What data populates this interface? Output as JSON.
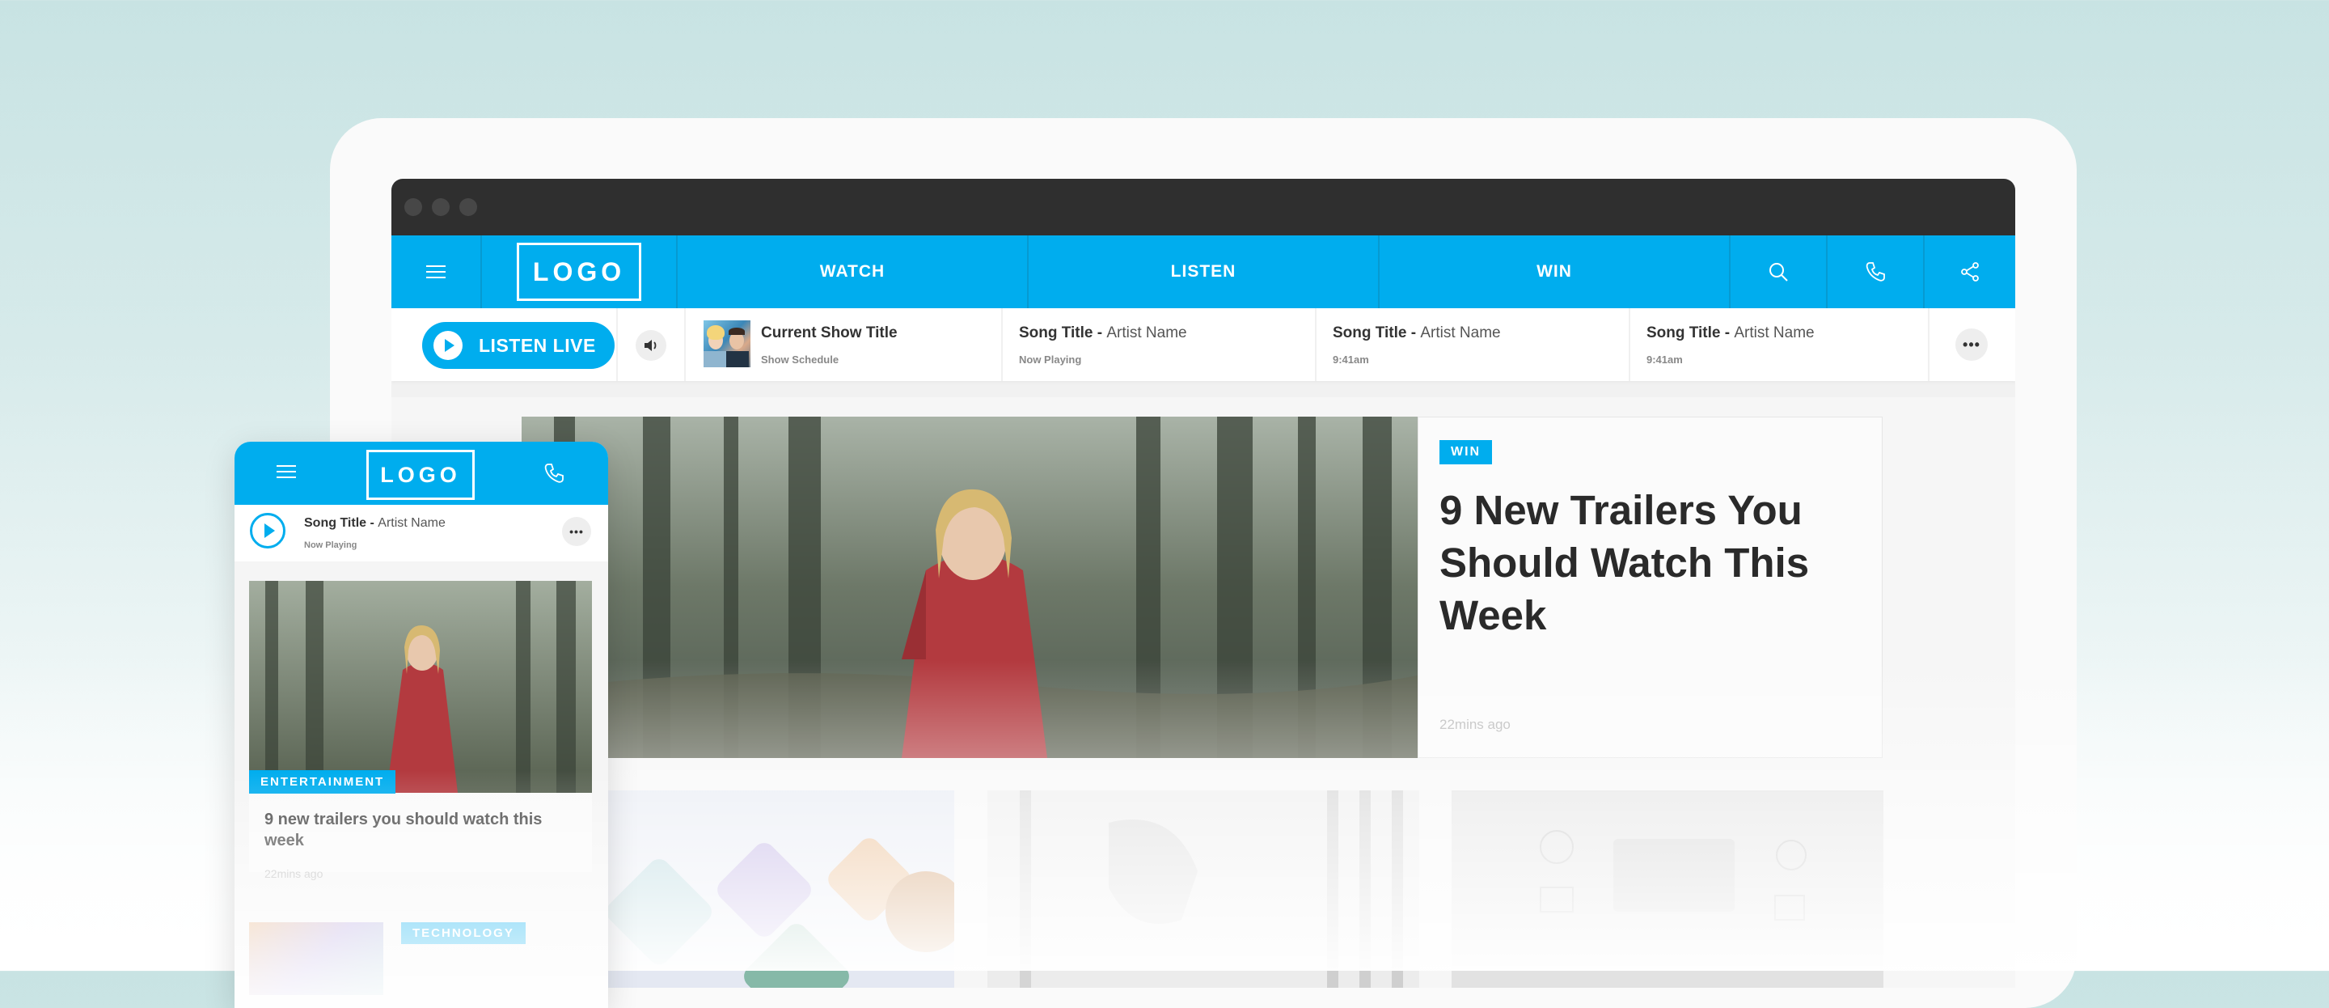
{
  "colors": {
    "brand": "#00adee",
    "titlebar": "#2f2f2f",
    "text_dark": "#2a2a2a"
  },
  "nav": {
    "menu_icon": "hamburger-icon",
    "logo": "LOGO",
    "items": [
      {
        "label": "WATCH"
      },
      {
        "label": "LISTEN"
      },
      {
        "label": "WIN"
      }
    ],
    "icons": [
      "search-icon",
      "phone-icon",
      "share-icon"
    ]
  },
  "player": {
    "listen_live": "LISTEN LIVE",
    "volume_icon": "volume-icon",
    "show": {
      "title": "Current Show Title",
      "subtitle": "Show Schedule"
    },
    "tracks": [
      {
        "song": "Song Title",
        "artist": "Artist Name",
        "status": "Now Playing"
      },
      {
        "song": "Song Title",
        "artist": "Artist Name",
        "status": "9:41am"
      },
      {
        "song": "Song Title",
        "artist": "Artist Name",
        "status": "9:41am"
      }
    ],
    "separator": " - ",
    "more_icon": "ellipsis-icon"
  },
  "hero": {
    "badge": "WIN",
    "headline": "9 New Trailers You Should Watch This Week",
    "time": "22mins ago"
  },
  "mobile": {
    "logo": "LOGO",
    "track": {
      "song": "Song Title",
      "artist": "Artist Name",
      "status": "Now Playing"
    },
    "card": {
      "category": "ENTERTAINMENT",
      "title": "9 new trailers you should watch this week",
      "time": "22mins ago"
    },
    "next_category": "TECHNOLOGY"
  }
}
